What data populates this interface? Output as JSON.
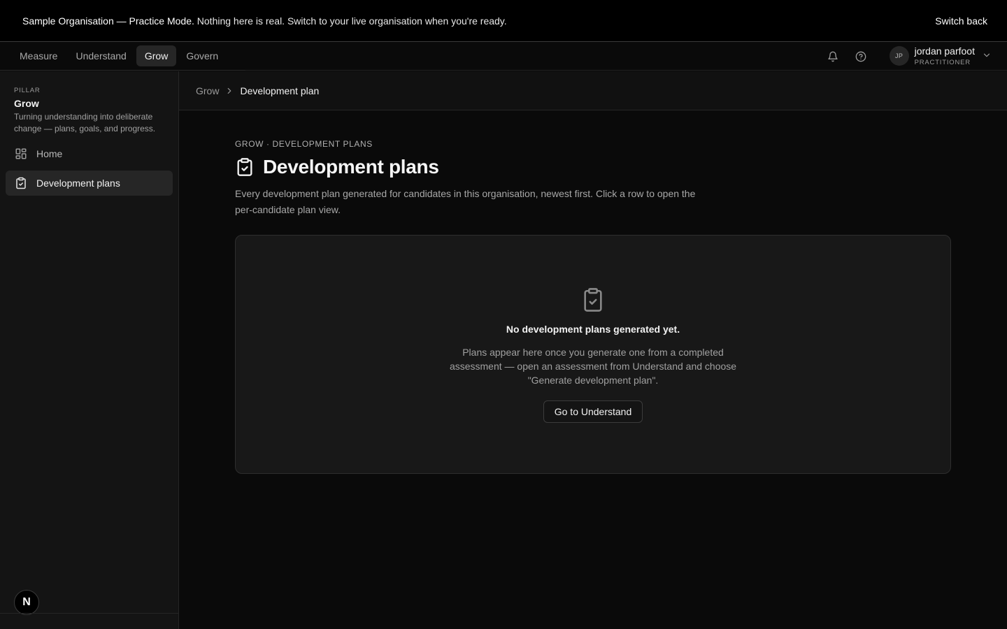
{
  "banner": {
    "strong_text": "Sample Organisation — Practice Mode.",
    "text": "Nothing here is real. Switch to your live organisation when you're ready.",
    "action_label": "Switch back"
  },
  "nav": {
    "tabs": [
      {
        "label": "Measure",
        "active": false
      },
      {
        "label": "Understand",
        "active": false
      },
      {
        "label": "Grow",
        "active": true
      },
      {
        "label": "Govern",
        "active": false
      }
    ],
    "icons": [
      "bell-icon",
      "help-icon"
    ],
    "user": {
      "initials": "JP",
      "name": "jordan parfoot",
      "role": "PRACTITIONER"
    }
  },
  "sidebar": {
    "pillar_label": "PILLAR",
    "pillar_name": "Grow",
    "pillar_description": "Turning understanding into deliberate change — plans, goals, and progress.",
    "items": [
      {
        "label": "Home",
        "icon": "grid-icon",
        "active": false
      },
      {
        "label": "Development plans",
        "icon": "clipboard-check-icon",
        "active": true
      }
    ],
    "logo_letter": "N"
  },
  "breadcrumb": {
    "parent": "Grow",
    "current": "Development plan"
  },
  "main": {
    "eyebrow": "GROW · DEVELOPMENT PLANS",
    "title": "Development plans",
    "subtitle": "Every development plan generated for candidates in this organisation, newest first. Click a row to open the per-candidate plan view.",
    "empty_state": {
      "icon": "clipboard-check-icon",
      "title": "No development plans generated yet.",
      "description": "Plans appear here once you generate one from a completed assessment — open an assessment from Understand and choose \"Generate development plan\".",
      "cta_label": "Go to Understand"
    }
  },
  "colors": {
    "background": "#0a0a0a",
    "sidebar": "#141414",
    "card": "#181818",
    "active_tab": "#262626"
  }
}
